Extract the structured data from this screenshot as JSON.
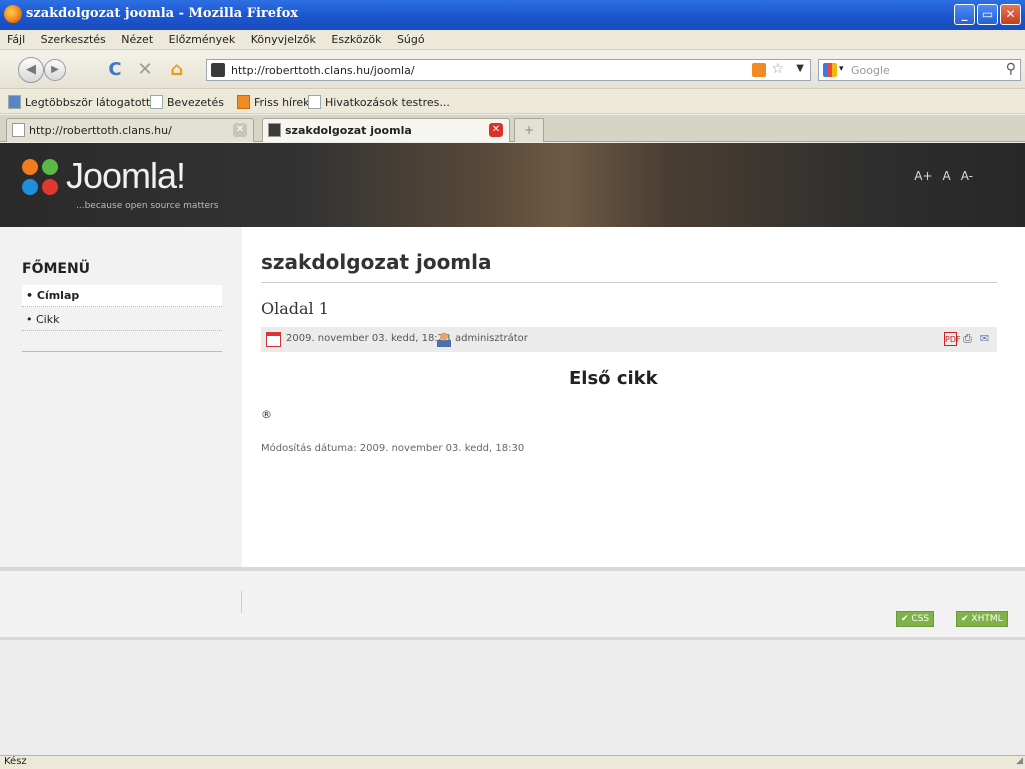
{
  "window": {
    "title": "szakdolgozat joomla - Mozilla Firefox",
    "minimize": "_",
    "maximize": "▭",
    "close": "✕"
  },
  "menubar": [
    "Fájl",
    "Szerkesztés",
    "Nézet",
    "Előzmények",
    "Könyvjelzők",
    "Eszközök",
    "Súgó"
  ],
  "navbar": {
    "back": "◀",
    "forward": "▶",
    "reload": "C",
    "stop": "✕",
    "home": "⌂",
    "url": "http://roberttoth.clans.hu/joomla/",
    "search_placeholder": "Google"
  },
  "bookmarks": [
    "Legtöbbször látogatott",
    "Bevezetés",
    "Friss hírek",
    "Hivatkozások testres..."
  ],
  "tabs": [
    {
      "label": "http://roberttoth.clans.hu/",
      "active": false
    },
    {
      "label": "szakdolgozat joomla",
      "active": true
    }
  ],
  "site": {
    "logo_text": "Joomla!",
    "tagline": "...because open source matters",
    "font_controls": [
      "A+",
      "A",
      "A-"
    ],
    "menu_title": "FŐMENÜ",
    "menu_items": [
      {
        "label": "Címlap",
        "active": true
      },
      {
        "label": "Cikk",
        "active": false
      }
    ],
    "page_title": "szakdolgozat joomla",
    "article": {
      "title": "Oladal 1",
      "date": "2009. november 03. kedd, 18:28",
      "author": "adminisztrátor",
      "heading": "Első cikk",
      "body_symbol": "®",
      "modified": "Módosítás dátuma: 2009. november 03. kedd, 18:30"
    },
    "badges": [
      "CSS",
      "XHTML"
    ]
  },
  "status": {
    "text": "Kész"
  },
  "colors": {
    "titlebar": "#1b55cf",
    "badge": "#7fb34a",
    "header": "#2a2a2a"
  }
}
